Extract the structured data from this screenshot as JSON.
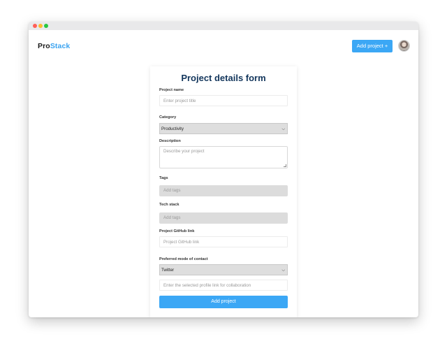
{
  "brand": {
    "part1": "Pro",
    "part2": "Stack"
  },
  "navbar": {
    "add_project_label": "Add project +"
  },
  "form": {
    "title": "Project details form",
    "project_name": {
      "label": "Project name",
      "placeholder": "Enter project title"
    },
    "category": {
      "label": "Category",
      "selected": "Productivity"
    },
    "description": {
      "label": "Description",
      "placeholder": "Describe your project"
    },
    "tags": {
      "label": "Tags",
      "placeholder": "Add tags"
    },
    "tech_stack": {
      "label": "Tech stack",
      "placeholder": "Add tags"
    },
    "github": {
      "label": "Project GitHub link",
      "placeholder": "Project GitHub link"
    },
    "contact": {
      "label": "Preferred mode of contact",
      "selected": "Twitter",
      "link_placeholder": "Enter the selected profile link for collaboration"
    },
    "submit_label": "Add project"
  },
  "colors": {
    "accent": "#3ba7f5",
    "title": "#13365c",
    "brand_stack": "#3aa3f0"
  },
  "icons": {
    "select_arrow": "chevron-down-icon",
    "avatar": "user-avatar"
  }
}
